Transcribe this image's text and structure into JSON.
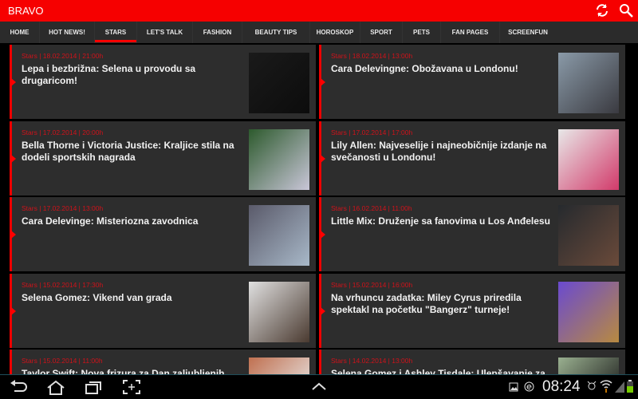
{
  "app": {
    "title": "BRAVO",
    "refresh_icon": "refresh-icon",
    "search_icon": "search-icon",
    "accent": "#f60000"
  },
  "tabs": [
    {
      "label": "HOME"
    },
    {
      "label": "HOT NEWS!"
    },
    {
      "label": "STARS",
      "active": true
    },
    {
      "label": "LET'S TALK"
    },
    {
      "label": "FASHION"
    },
    {
      "label": "BEAUTY TIPS"
    },
    {
      "label": "HOROSKOP"
    },
    {
      "label": "SPORT"
    },
    {
      "label": "PETS"
    },
    {
      "label": "FAN PAGES"
    },
    {
      "label": "SCREENFUN"
    }
  ],
  "articles": [
    {
      "meta": "Stars | 18.02.2014 | 21:00h",
      "title": "Lepa i bezbrižna: Selena u provodu sa drugaricom!"
    },
    {
      "meta": "Stars | 18.02.2014 | 13:00h",
      "title": "Cara Delevingne: Obožavana u Londonu!"
    },
    {
      "meta": "Stars | 17.02.2014 | 20:00h",
      "title": "Bella Thorne i Victoria Justice: Kraljice stila na dodeli sportskih nagrada"
    },
    {
      "meta": "Stars | 17.02.2014 | 17:00h",
      "title": "Lily Allen: Najveselije i najneobičnije izdanje na svečanosti u Londonu!"
    },
    {
      "meta": "Stars | 17.02.2014 | 13:00h",
      "title": "Cara Delevinge: Misteriozna zavodnica"
    },
    {
      "meta": "Stars | 16.02.2014 | 11:00h",
      "title": "Little Mix: Druženje sa fanovima u Los Anđelesu"
    },
    {
      "meta": "Stars | 15.02.2014 | 17:30h",
      "title": "Selena Gomez: Vikend van grada"
    },
    {
      "meta": "Stars | 15.02.2014 | 16:00h",
      "title": "Na vrhuncu zadatka: Miley Cyrus priredila spektakl na početku \"Bangerz\" turneje!"
    },
    {
      "meta": "Stars | 15.02.2014 | 11:00h",
      "title": "Taylor Swift: Nova frizura za Dan zaljubljenih"
    },
    {
      "meta": "Stars | 14.02.2014 | 13:00h",
      "title": "Selena Gomez i Ashley Tisdale: Ulepšavanje za"
    }
  ],
  "system": {
    "time": "08:24"
  }
}
